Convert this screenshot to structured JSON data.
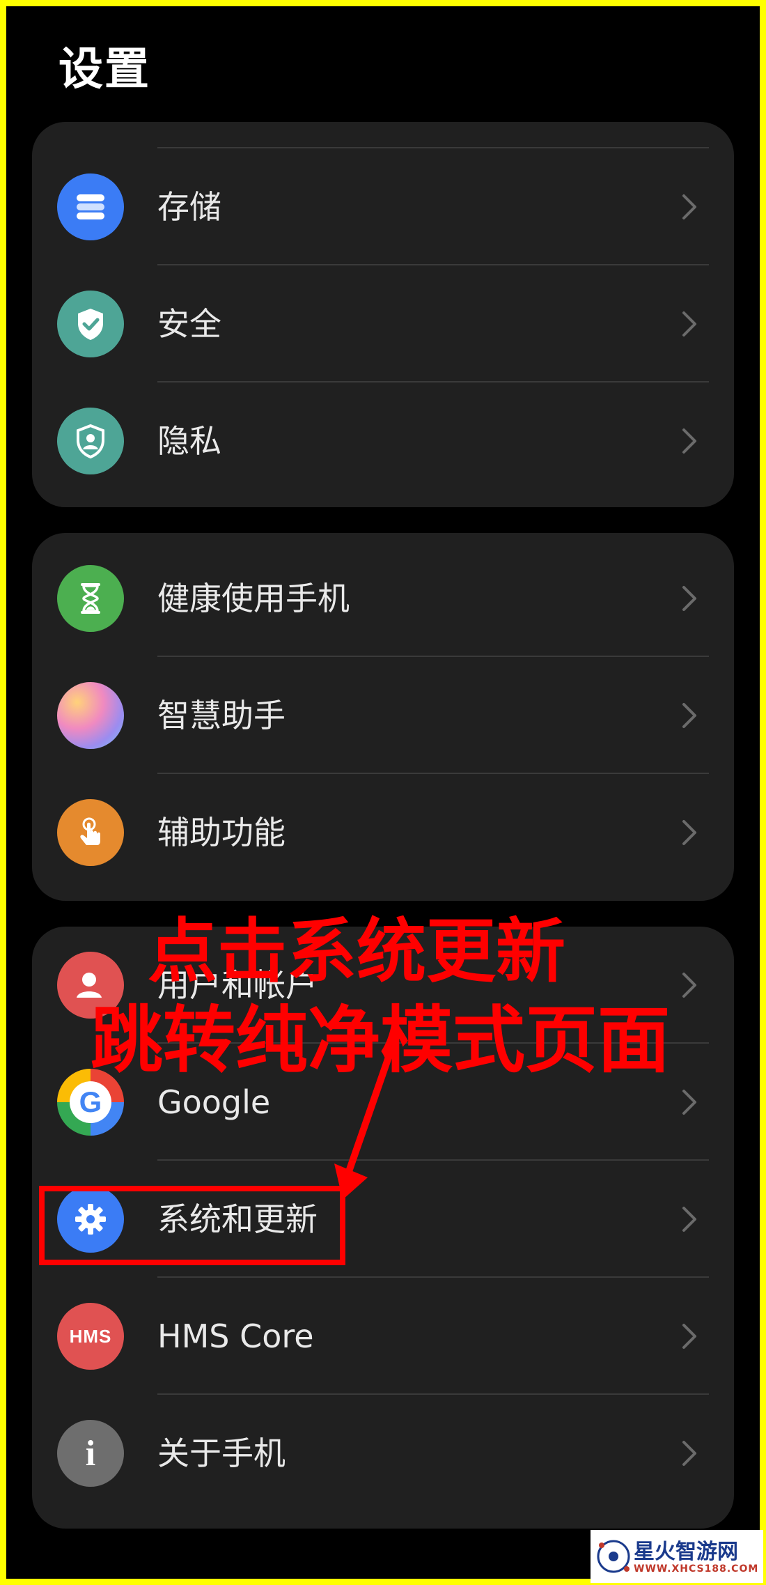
{
  "header": {
    "title": "设置"
  },
  "groups": [
    {
      "items": [
        {
          "label": "存储",
          "icon": "storage-icon",
          "color": "#3b7cf5"
        },
        {
          "label": "安全",
          "icon": "shield-check-icon",
          "color": "#4ea596"
        },
        {
          "label": "隐私",
          "icon": "privacy-shield-icon",
          "color": "#4ea596"
        }
      ]
    },
    {
      "items": [
        {
          "label": "健康使用手机",
          "icon": "hourglass-icon",
          "color": "#4caf50"
        },
        {
          "label": "智慧助手",
          "icon": "smart-assistant-icon",
          "color": "#c48be8"
        },
        {
          "label": "辅助功能",
          "icon": "accessibility-hand-icon",
          "color": "#e58a2e"
        }
      ]
    },
    {
      "items": [
        {
          "label": "用户和帐户",
          "icon": "user-account-icon",
          "color": "#e05252"
        },
        {
          "label": "Google",
          "icon": "google-icon",
          "color": "#ffffff"
        },
        {
          "label": "系统和更新",
          "icon": "gear-icon",
          "color": "#3b7cf5"
        },
        {
          "label": "HMS Core",
          "icon": "hms-icon",
          "color": "#e05252",
          "icon_text": "HMS"
        },
        {
          "label": "关于手机",
          "icon": "info-icon",
          "color": "#6e6e6e",
          "icon_text": "i"
        }
      ]
    }
  ],
  "annotation": {
    "line1": "点击系统更新",
    "line2": "跳转纯净模式页面",
    "color": "#ff0000"
  },
  "watermark": {
    "main": "星火智游网",
    "sub": "WWW.XHCS188.COM"
  }
}
